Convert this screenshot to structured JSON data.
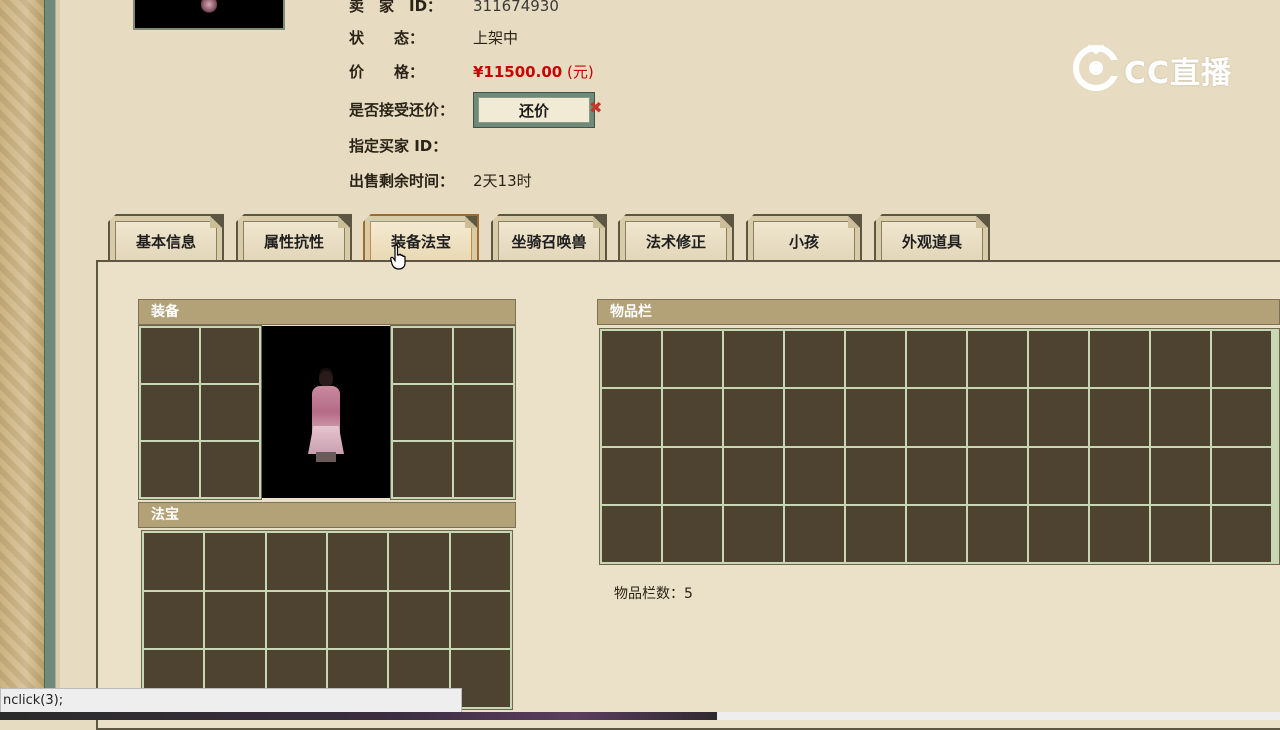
{
  "seller": {
    "seller_label": "卖　家　ID：",
    "seller_id": "311674930",
    "status_label": "状　　态：",
    "status_value": "上架中",
    "price_label": "价　　格：",
    "price_value": "¥11500.00",
    "price_unit": "(元)",
    "haggle_label": "是否接受还价：",
    "haggle_button": "还价",
    "buyer_id_label": "指定买家 ID：",
    "remaining_label": "出售剩余时间：",
    "remaining_value": "2天13时"
  },
  "watermark": {
    "text": "CC直播"
  },
  "tabs": [
    {
      "label": "基本信息"
    },
    {
      "label": "属性抗性"
    },
    {
      "label": "装备法宝",
      "active": true
    },
    {
      "label": "坐骑召唤兽"
    },
    {
      "label": "法术修正"
    },
    {
      "label": "小孩"
    },
    {
      "label": "外观道具"
    }
  ],
  "equipment": {
    "header": "装备"
  },
  "treasure": {
    "header": "法宝"
  },
  "inventory": {
    "header": "物品栏",
    "slot_count_label": "物品栏数：",
    "slot_count": "5"
  },
  "statusbar": {
    "text": "nclick(3);"
  },
  "colors": {
    "price_red": "#cc0000",
    "cell_dark": "#4d4330",
    "grid_line": "#c7d7b4",
    "header_tan": "#b3a177"
  }
}
